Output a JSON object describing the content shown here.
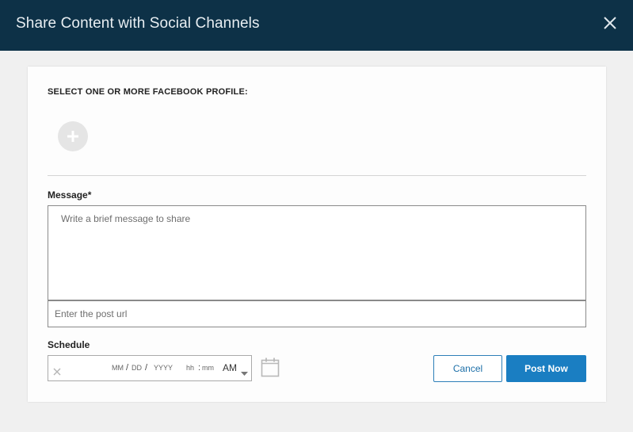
{
  "dialog": {
    "title": "Share Content with Social Channels"
  },
  "profiles": {
    "label": "SELECT ONE OR MORE FACEBOOK PROFILE:"
  },
  "message": {
    "label": "Message*",
    "value": "",
    "placeholder": "Write a brief message to share"
  },
  "post_url": {
    "value": "",
    "placeholder": "Enter the post url"
  },
  "schedule": {
    "label": "Schedule",
    "month": "MM",
    "day": "DD",
    "year": "YYYY",
    "hour": "hh",
    "minute": "mm",
    "date_separator": "/",
    "time_separator": ":",
    "ampm": "AM"
  },
  "actions": {
    "cancel_label": "Cancel",
    "post_label": "Post Now"
  },
  "colors": {
    "header_bg": "#0d3147",
    "primary": "#1a7ec2",
    "page_bg": "#f0f0f0"
  },
  "icons": {
    "close": "close-icon",
    "add_profile": "plus-icon",
    "clear": "clear-icon",
    "caret": "chevron-down-icon",
    "calendar": "calendar-icon"
  }
}
